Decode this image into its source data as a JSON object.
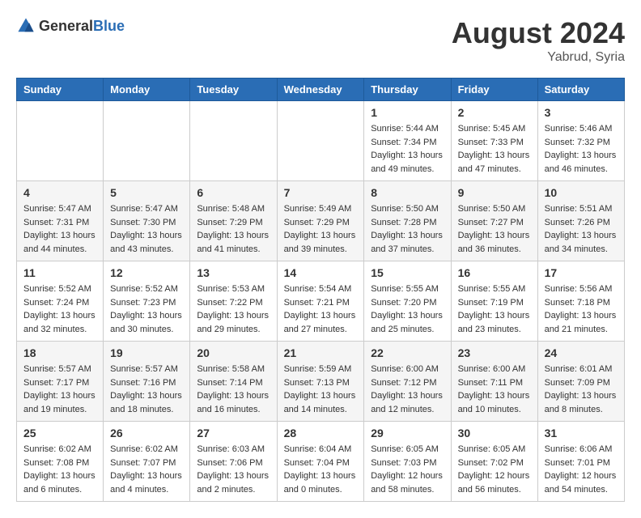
{
  "header": {
    "logo_general": "General",
    "logo_blue": "Blue",
    "title": "August 2024",
    "location": "Yabrud, Syria"
  },
  "weekdays": [
    "Sunday",
    "Monday",
    "Tuesday",
    "Wednesday",
    "Thursday",
    "Friday",
    "Saturday"
  ],
  "weeks": [
    [
      {
        "day": "",
        "info": ""
      },
      {
        "day": "",
        "info": ""
      },
      {
        "day": "",
        "info": ""
      },
      {
        "day": "",
        "info": ""
      },
      {
        "day": "1",
        "info": "Sunrise: 5:44 AM\nSunset: 7:34 PM\nDaylight: 13 hours\nand 49 minutes."
      },
      {
        "day": "2",
        "info": "Sunrise: 5:45 AM\nSunset: 7:33 PM\nDaylight: 13 hours\nand 47 minutes."
      },
      {
        "day": "3",
        "info": "Sunrise: 5:46 AM\nSunset: 7:32 PM\nDaylight: 13 hours\nand 46 minutes."
      }
    ],
    [
      {
        "day": "4",
        "info": "Sunrise: 5:47 AM\nSunset: 7:31 PM\nDaylight: 13 hours\nand 44 minutes."
      },
      {
        "day": "5",
        "info": "Sunrise: 5:47 AM\nSunset: 7:30 PM\nDaylight: 13 hours\nand 43 minutes."
      },
      {
        "day": "6",
        "info": "Sunrise: 5:48 AM\nSunset: 7:29 PM\nDaylight: 13 hours\nand 41 minutes."
      },
      {
        "day": "7",
        "info": "Sunrise: 5:49 AM\nSunset: 7:29 PM\nDaylight: 13 hours\nand 39 minutes."
      },
      {
        "day": "8",
        "info": "Sunrise: 5:50 AM\nSunset: 7:28 PM\nDaylight: 13 hours\nand 37 minutes."
      },
      {
        "day": "9",
        "info": "Sunrise: 5:50 AM\nSunset: 7:27 PM\nDaylight: 13 hours\nand 36 minutes."
      },
      {
        "day": "10",
        "info": "Sunrise: 5:51 AM\nSunset: 7:26 PM\nDaylight: 13 hours\nand 34 minutes."
      }
    ],
    [
      {
        "day": "11",
        "info": "Sunrise: 5:52 AM\nSunset: 7:24 PM\nDaylight: 13 hours\nand 32 minutes."
      },
      {
        "day": "12",
        "info": "Sunrise: 5:52 AM\nSunset: 7:23 PM\nDaylight: 13 hours\nand 30 minutes."
      },
      {
        "day": "13",
        "info": "Sunrise: 5:53 AM\nSunset: 7:22 PM\nDaylight: 13 hours\nand 29 minutes."
      },
      {
        "day": "14",
        "info": "Sunrise: 5:54 AM\nSunset: 7:21 PM\nDaylight: 13 hours\nand 27 minutes."
      },
      {
        "day": "15",
        "info": "Sunrise: 5:55 AM\nSunset: 7:20 PM\nDaylight: 13 hours\nand 25 minutes."
      },
      {
        "day": "16",
        "info": "Sunrise: 5:55 AM\nSunset: 7:19 PM\nDaylight: 13 hours\nand 23 minutes."
      },
      {
        "day": "17",
        "info": "Sunrise: 5:56 AM\nSunset: 7:18 PM\nDaylight: 13 hours\nand 21 minutes."
      }
    ],
    [
      {
        "day": "18",
        "info": "Sunrise: 5:57 AM\nSunset: 7:17 PM\nDaylight: 13 hours\nand 19 minutes."
      },
      {
        "day": "19",
        "info": "Sunrise: 5:57 AM\nSunset: 7:16 PM\nDaylight: 13 hours\nand 18 minutes."
      },
      {
        "day": "20",
        "info": "Sunrise: 5:58 AM\nSunset: 7:14 PM\nDaylight: 13 hours\nand 16 minutes."
      },
      {
        "day": "21",
        "info": "Sunrise: 5:59 AM\nSunset: 7:13 PM\nDaylight: 13 hours\nand 14 minutes."
      },
      {
        "day": "22",
        "info": "Sunrise: 6:00 AM\nSunset: 7:12 PM\nDaylight: 13 hours\nand 12 minutes."
      },
      {
        "day": "23",
        "info": "Sunrise: 6:00 AM\nSunset: 7:11 PM\nDaylight: 13 hours\nand 10 minutes."
      },
      {
        "day": "24",
        "info": "Sunrise: 6:01 AM\nSunset: 7:09 PM\nDaylight: 13 hours\nand 8 minutes."
      }
    ],
    [
      {
        "day": "25",
        "info": "Sunrise: 6:02 AM\nSunset: 7:08 PM\nDaylight: 13 hours\nand 6 minutes."
      },
      {
        "day": "26",
        "info": "Sunrise: 6:02 AM\nSunset: 7:07 PM\nDaylight: 13 hours\nand 4 minutes."
      },
      {
        "day": "27",
        "info": "Sunrise: 6:03 AM\nSunset: 7:06 PM\nDaylight: 13 hours\nand 2 minutes."
      },
      {
        "day": "28",
        "info": "Sunrise: 6:04 AM\nSunset: 7:04 PM\nDaylight: 13 hours\nand 0 minutes."
      },
      {
        "day": "29",
        "info": "Sunrise: 6:05 AM\nSunset: 7:03 PM\nDaylight: 12 hours\nand 58 minutes."
      },
      {
        "day": "30",
        "info": "Sunrise: 6:05 AM\nSunset: 7:02 PM\nDaylight: 12 hours\nand 56 minutes."
      },
      {
        "day": "31",
        "info": "Sunrise: 6:06 AM\nSunset: 7:01 PM\nDaylight: 12 hours\nand 54 minutes."
      }
    ]
  ]
}
